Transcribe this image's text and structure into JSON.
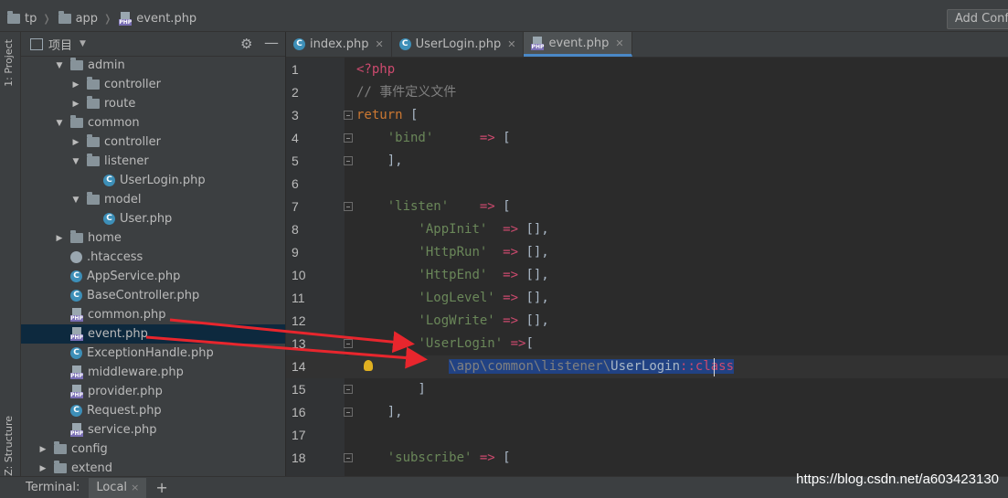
{
  "breadcrumb": [
    {
      "label": "tp",
      "type": "folder"
    },
    {
      "label": "app",
      "type": "folder"
    },
    {
      "label": "event.php",
      "type": "php"
    }
  ],
  "toolbar": {
    "add_config_label": "Add Conf"
  },
  "left_stripe": {
    "project_label": "1: Project",
    "structure_label": "Z: Structure"
  },
  "project_panel": {
    "title": "项目"
  },
  "tree": [
    {
      "label": "admin",
      "depth": 2,
      "arrow": "open",
      "icon": "folder"
    },
    {
      "label": "controller",
      "depth": 3,
      "arrow": "closed",
      "icon": "folder"
    },
    {
      "label": "route",
      "depth": 3,
      "arrow": "closed",
      "icon": "folder"
    },
    {
      "label": "common",
      "depth": 2,
      "arrow": "open",
      "icon": "folder"
    },
    {
      "label": "controller",
      "depth": 3,
      "arrow": "closed",
      "icon": "folder"
    },
    {
      "label": "listener",
      "depth": 3,
      "arrow": "open",
      "icon": "folder"
    },
    {
      "label": "UserLogin.php",
      "depth": 4,
      "arrow": "none",
      "icon": "class"
    },
    {
      "label": "model",
      "depth": 3,
      "arrow": "open",
      "icon": "folder"
    },
    {
      "label": "User.php",
      "depth": 4,
      "arrow": "none",
      "icon": "class"
    },
    {
      "label": "home",
      "depth": 2,
      "arrow": "closed",
      "icon": "folder"
    },
    {
      "label": ".htaccess",
      "depth": 2,
      "arrow": "none",
      "icon": "file"
    },
    {
      "label": "AppService.php",
      "depth": 2,
      "arrow": "none",
      "icon": "class"
    },
    {
      "label": "BaseController.php",
      "depth": 2,
      "arrow": "none",
      "icon": "class"
    },
    {
      "label": "common.php",
      "depth": 2,
      "arrow": "none",
      "icon": "php"
    },
    {
      "label": "event.php",
      "depth": 2,
      "arrow": "none",
      "icon": "php",
      "selected": true
    },
    {
      "label": "ExceptionHandle.php",
      "depth": 2,
      "arrow": "none",
      "icon": "class"
    },
    {
      "label": "middleware.php",
      "depth": 2,
      "arrow": "none",
      "icon": "php"
    },
    {
      "label": "provider.php",
      "depth": 2,
      "arrow": "none",
      "icon": "php"
    },
    {
      "label": "Request.php",
      "depth": 2,
      "arrow": "none",
      "icon": "class"
    },
    {
      "label": "service.php",
      "depth": 2,
      "arrow": "none",
      "icon": "php"
    },
    {
      "label": "config",
      "depth": 1,
      "arrow": "closed",
      "icon": "folder"
    },
    {
      "label": "extend",
      "depth": 1,
      "arrow": "closed",
      "icon": "folder"
    }
  ],
  "tabs": [
    {
      "label": "index.php",
      "icon": "class",
      "active": false
    },
    {
      "label": "UserLogin.php",
      "icon": "class",
      "active": false
    },
    {
      "label": "event.php",
      "icon": "php",
      "active": true
    }
  ],
  "code_lines": [
    {
      "n": "1",
      "segments": [
        {
          "t": "<?php",
          "c": "php"
        }
      ]
    },
    {
      "n": "2",
      "segments": [
        {
          "t": "// 事件定义文件",
          "c": "cm"
        }
      ]
    },
    {
      "n": "3",
      "fold": true,
      "segments": [
        {
          "t": "return",
          "c": "kw"
        },
        {
          "t": " [",
          "c": "cls"
        }
      ]
    },
    {
      "n": "4",
      "fold": true,
      "segments": [
        {
          "t": "    ",
          "c": "cls"
        },
        {
          "t": "'bind'",
          "c": "str"
        },
        {
          "t": "      ",
          "c": "cls"
        },
        {
          "t": "=>",
          "c": "op"
        },
        {
          "t": " [",
          "c": "cls"
        }
      ]
    },
    {
      "n": "5",
      "fold": true,
      "segments": [
        {
          "t": "    ],",
          "c": "cls"
        }
      ]
    },
    {
      "n": "6",
      "segments": []
    },
    {
      "n": "7",
      "fold": true,
      "segments": [
        {
          "t": "    ",
          "c": "cls"
        },
        {
          "t": "'listen'",
          "c": "str"
        },
        {
          "t": "    ",
          "c": "cls"
        },
        {
          "t": "=>",
          "c": "op"
        },
        {
          "t": " [",
          "c": "cls"
        }
      ]
    },
    {
      "n": "8",
      "segments": [
        {
          "t": "        ",
          "c": "cls"
        },
        {
          "t": "'AppInit'",
          "c": "str"
        },
        {
          "t": "  ",
          "c": "cls"
        },
        {
          "t": "=>",
          "c": "op"
        },
        {
          "t": " [],",
          "c": "cls"
        }
      ]
    },
    {
      "n": "9",
      "segments": [
        {
          "t": "        ",
          "c": "cls"
        },
        {
          "t": "'HttpRun'",
          "c": "str"
        },
        {
          "t": "  ",
          "c": "cls"
        },
        {
          "t": "=>",
          "c": "op"
        },
        {
          "t": " [],",
          "c": "cls"
        }
      ]
    },
    {
      "n": "10",
      "segments": [
        {
          "t": "        ",
          "c": "cls"
        },
        {
          "t": "'HttpEnd'",
          "c": "str"
        },
        {
          "t": "  ",
          "c": "cls"
        },
        {
          "t": "=>",
          "c": "op"
        },
        {
          "t": " [],",
          "c": "cls"
        }
      ]
    },
    {
      "n": "11",
      "segments": [
        {
          "t": "        ",
          "c": "cls"
        },
        {
          "t": "'LogLevel'",
          "c": "str"
        },
        {
          "t": " ",
          "c": "cls"
        },
        {
          "t": "=>",
          "c": "op"
        },
        {
          "t": " [],",
          "c": "cls"
        }
      ]
    },
    {
      "n": "12",
      "segments": [
        {
          "t": "        ",
          "c": "cls"
        },
        {
          "t": "'LogWrite'",
          "c": "str"
        },
        {
          "t": " ",
          "c": "cls"
        },
        {
          "t": "=>",
          "c": "op"
        },
        {
          "t": " [],",
          "c": "cls"
        }
      ]
    },
    {
      "n": "13",
      "fold": true,
      "segments": [
        {
          "t": "        ",
          "c": "cls"
        },
        {
          "t": "'UserLogin'",
          "c": "str"
        },
        {
          "t": " ",
          "c": "cls"
        },
        {
          "t": "=>",
          "c": "op"
        },
        {
          "t": "[",
          "c": "cls"
        }
      ]
    },
    {
      "n": "14",
      "current": true,
      "segments": [
        {
          "t": "            ",
          "c": "cls"
        },
        {
          "t": "\\app\\common\\listener\\",
          "c": "ns sel"
        },
        {
          "t": "UserLogin",
          "c": "cls sel"
        },
        {
          "t": "::class",
          "c": "php sel"
        }
      ]
    },
    {
      "n": "15",
      "fold": true,
      "segments": [
        {
          "t": "        ]",
          "c": "cls"
        }
      ]
    },
    {
      "n": "16",
      "fold": true,
      "segments": [
        {
          "t": "    ],",
          "c": "cls"
        }
      ]
    },
    {
      "n": "17",
      "segments": []
    },
    {
      "n": "18",
      "fold": true,
      "segments": [
        {
          "t": "    ",
          "c": "cls"
        },
        {
          "t": "'subscribe'",
          "c": "str"
        },
        {
          "t": " ",
          "c": "cls"
        },
        {
          "t": "=>",
          "c": "op"
        },
        {
          "t": " [",
          "c": "cls"
        }
      ]
    }
  ],
  "bottom": {
    "terminal_label": "Terminal:",
    "local_label": "Local",
    "close_x": "×",
    "plus": "+"
  },
  "watermark": "https://blog.csdn.net/a603423130",
  "colors": {
    "keyword": "#cc7832",
    "string": "#6a8759",
    "comment": "#808080",
    "operator": "#cc4a6e",
    "selection": "#214283",
    "arrow": "#e8262d"
  }
}
